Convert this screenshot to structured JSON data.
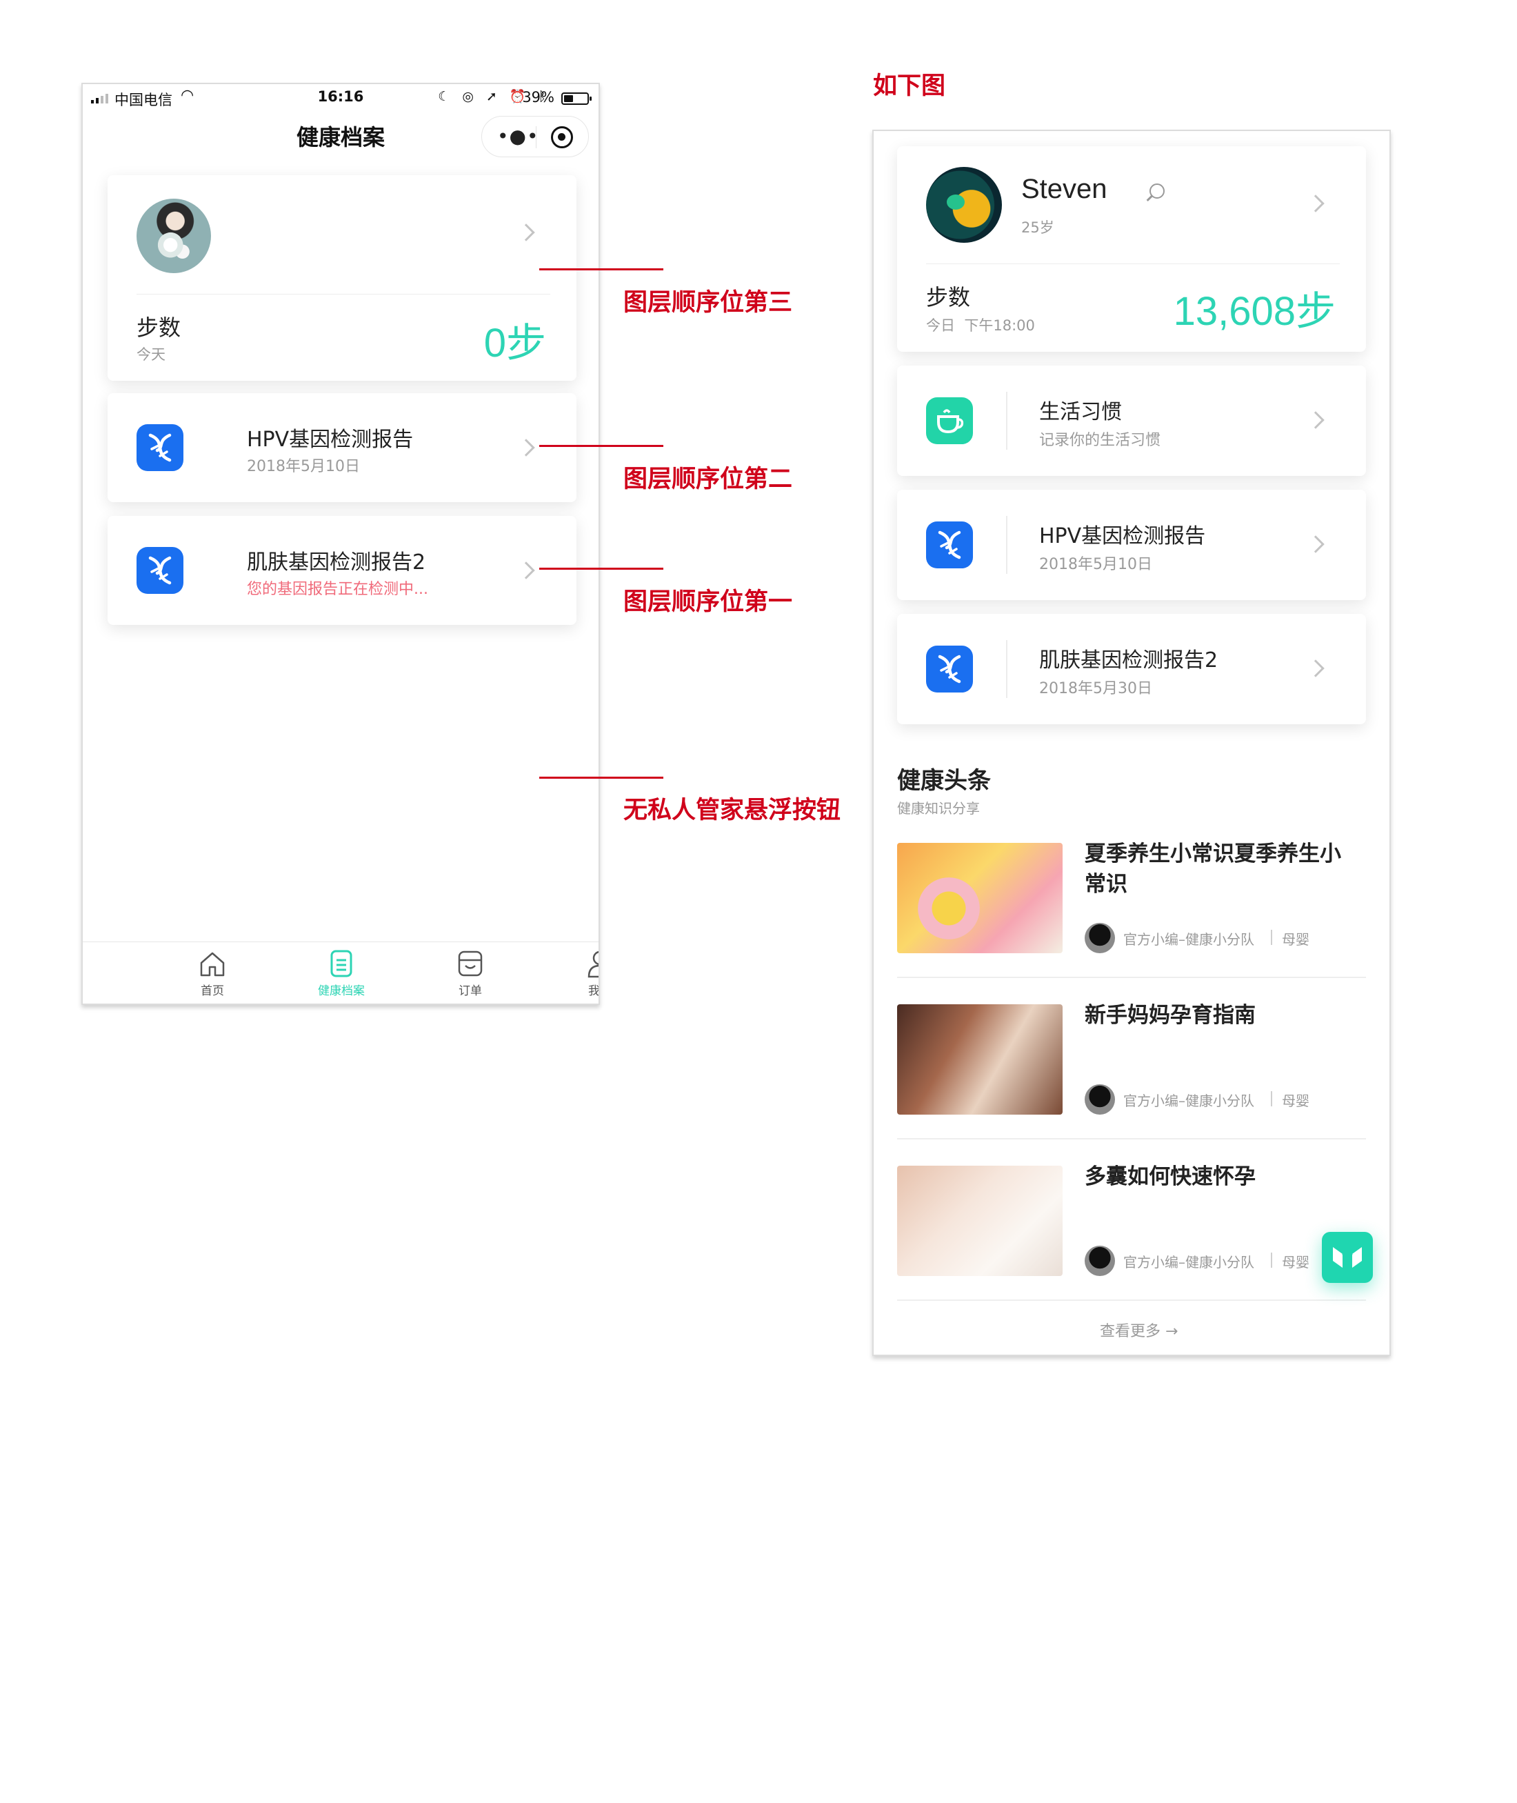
{
  "left_phone": {
    "status_bar": {
      "carrier": "中国电信",
      "time": "16:16",
      "battery": "39%"
    },
    "nav": {
      "title": "健康档案"
    },
    "profile_card": {
      "steps_label": "步数",
      "steps_sub": "今天",
      "steps_value": "0步"
    },
    "items": [
      {
        "title": "HPV基因检测报告",
        "sub": "2018年5月10日"
      },
      {
        "title": "肌肤基因检测报告2",
        "sub": "您的基因报告正在检测中..."
      }
    ],
    "tabbar": [
      {
        "label": "首页",
        "icon": "home-icon",
        "active": false
      },
      {
        "label": "健康档案",
        "icon": "health-record-icon",
        "active": true
      },
      {
        "label": "订单",
        "icon": "order-icon",
        "active": false
      },
      {
        "label": "我的",
        "icon": "user-icon",
        "active": false
      }
    ]
  },
  "annotations": [
    {
      "text": "图层顺序位第三"
    },
    {
      "text": "图层顺序位第二"
    },
    {
      "text": "图层顺序位第一"
    },
    {
      "text": "无私人管家悬浮按钮"
    }
  ],
  "right_note": "如下图",
  "right_phone": {
    "profile_card": {
      "name": "Steven",
      "age": "25岁",
      "steps_label": "步数",
      "steps_sub": "今日  下午18:00",
      "steps_value": "13,608步"
    },
    "items": [
      {
        "title": "生活习惯",
        "sub": "记录你的生活习惯",
        "icon": "cup-icon"
      },
      {
        "title": "HPV基因检测报告",
        "sub": "2018年5月10日",
        "icon": "dna-icon"
      },
      {
        "title": "肌肤基因检测报告2",
        "sub": "2018年5月30日",
        "icon": "dna-icon"
      }
    ],
    "news": {
      "title": "健康头条",
      "subtitle": "健康知识分享",
      "articles": [
        {
          "title": "夏季养生小常识夏季养生小常识",
          "author": "官方小编–健康小分队",
          "tag": "母婴"
        },
        {
          "title": "新手妈妈孕育指南",
          "author": "官方小编–健康小分队",
          "tag": "母婴"
        },
        {
          "title": "多囊如何快速怀孕",
          "author": "官方小编–健康小分队",
          "tag": "母婴"
        }
      ],
      "more": "查看更多 →"
    }
  },
  "colors": {
    "accent": "#2dd4b4",
    "annotation_red": "#d0021b",
    "icon_blue": "#1a6ff0",
    "alert_pink": "#f06a7a"
  }
}
